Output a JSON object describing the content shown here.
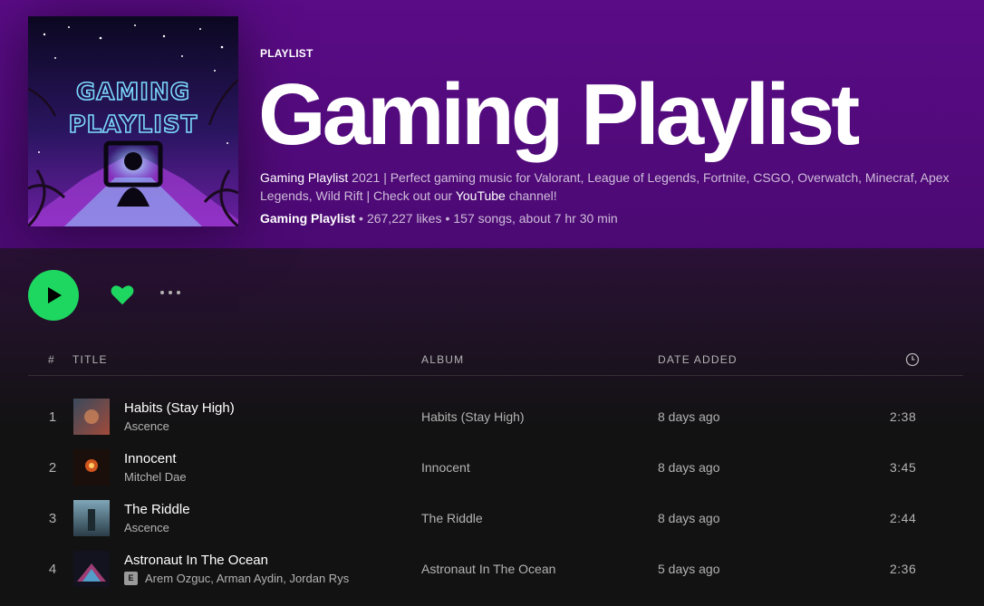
{
  "header": {
    "type_label": "PLAYLIST",
    "title": "Gaming Playlist",
    "cover_text_line1": "GAMING",
    "cover_text_line2": "PLAYLIST",
    "description_part1": "Gaming Playlist",
    "description_part2": " 2021 | Perfect gaming music for Valorant, League of Legends, Fortnite, CSGO, Overwatch, Minecraf, Apex Legends, Wild Rift | Check out our ",
    "description_link": "YouTube",
    "description_part3": " channel!",
    "owner": "Gaming Playlist",
    "likes": "267,227 likes",
    "summary": "157 songs, about 7 hr 30 min",
    "separator": "•"
  },
  "actions": {
    "play_icon": "play-icon",
    "heart_icon": "heart-icon",
    "more_icon": "more-icon"
  },
  "table": {
    "headers": {
      "number": "#",
      "title": "TITLE",
      "album": "ALBUM",
      "date_added": "DATE ADDED",
      "duration_icon": "clock-icon"
    },
    "rows": [
      {
        "number": "1",
        "title": "Habits (Stay High)",
        "artist": "Ascence",
        "album": "Habits (Stay High)",
        "date_added": "8 days ago",
        "duration": "2:38",
        "explicit": false
      },
      {
        "number": "2",
        "title": "Innocent",
        "artist": "Mitchel Dae",
        "album": "Innocent",
        "date_added": "8 days ago",
        "duration": "3:45",
        "explicit": false
      },
      {
        "number": "3",
        "title": "The Riddle",
        "artist": "Ascence",
        "album": "The Riddle",
        "date_added": "8 days ago",
        "duration": "2:44",
        "explicit": false
      },
      {
        "number": "4",
        "title": "Astronaut In The Ocean",
        "artist": "Arem Ozguc, Arman Aydin, Jordan Rys",
        "album": "Astronaut In The Ocean",
        "date_added": "5 days ago",
        "duration": "2:36",
        "explicit": true,
        "explicit_label": "E"
      }
    ]
  },
  "colors": {
    "accent": "#1ed760",
    "header_bg": "#5a0b86",
    "page_bg": "#121212",
    "muted_text": "#b3b3b3"
  }
}
